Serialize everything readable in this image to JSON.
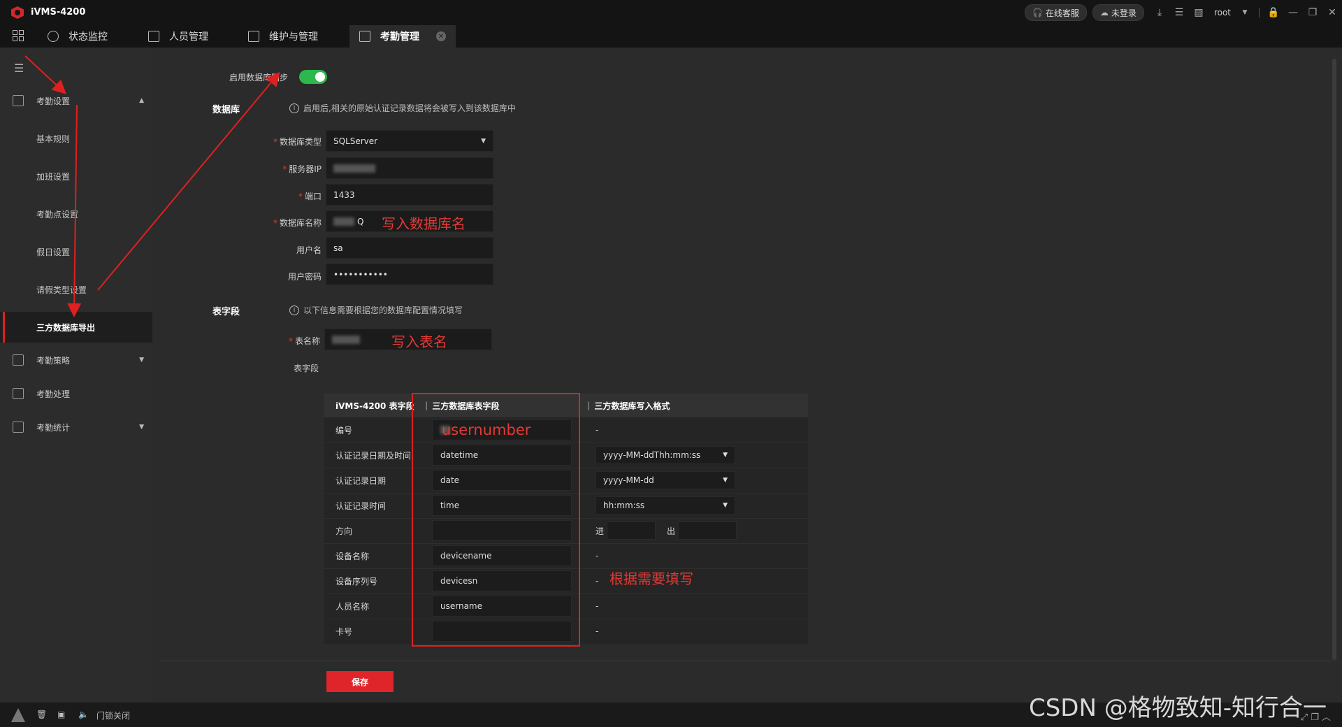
{
  "app": {
    "title": "iVMS-4200"
  },
  "titlebar": {
    "online_service": "在线客服",
    "not_logged_in": "未登录",
    "user": "root"
  },
  "tabs": [
    {
      "label": "状态监控"
    },
    {
      "label": "人员管理"
    },
    {
      "label": "维护与管理"
    },
    {
      "label": "考勤管理",
      "active": true
    }
  ],
  "sidebar": {
    "groups": [
      {
        "label": "考勤设置",
        "expanded": true,
        "items": [
          {
            "label": "基本规则"
          },
          {
            "label": "加班设置"
          },
          {
            "label": "考勤点设置"
          },
          {
            "label": "假日设置"
          },
          {
            "label": "请假类型设置"
          },
          {
            "label": "三方数据库导出",
            "active": true
          }
        ]
      },
      {
        "label": "考勤策略"
      },
      {
        "label": "考勤处理"
      },
      {
        "label": "考勤统计"
      }
    ]
  },
  "form": {
    "enable_sync_label": "启用数据库同步",
    "enable_sync": true,
    "db_section": "数据库",
    "db_hint": "启用后,相关的原始认证记录数据将会被写入到该数据库中",
    "db_type_label": "数据库类型",
    "db_type": "SQLServer",
    "server_ip_label": "服务器IP",
    "port_label": "端口",
    "port": "1433",
    "db_name_label": "数据库名称",
    "db_name_suffix": "Q",
    "username_label": "用户名",
    "username": "sa",
    "password_label": "用户密码",
    "password": "•••••••••••",
    "field_section": "表字段",
    "field_hint": "以下信息需要根据您的数据库配置情况填写",
    "table_name_label": "表名称",
    "table_fields_label": "表字段"
  },
  "annotations": {
    "db_name": "写入数据库名",
    "table_name": "写入表名",
    "fields": "根据需要填写",
    "usernumber": "usernumber"
  },
  "table": {
    "headers": [
      "iVMS-4200 表字段",
      "三方数据库表字段",
      "三方数据库写入格式"
    ],
    "rows": [
      {
        "field": "编号",
        "db_field": "",
        "format": "-"
      },
      {
        "field": "认证记录日期及时间",
        "db_field": "datetime",
        "format": "yyyy-MM-ddThh:mm:ss"
      },
      {
        "field": "认证记录日期",
        "db_field": "date",
        "format": "yyyy-MM-dd"
      },
      {
        "field": "认证记录时间",
        "db_field": "time",
        "format": "hh:mm:ss"
      },
      {
        "field": "方向",
        "db_field": "",
        "format": ""
      },
      {
        "field": "设备名称",
        "db_field": "devicename",
        "format": "-"
      },
      {
        "field": "设备序列号",
        "db_field": "devicesn",
        "format": "-"
      },
      {
        "field": "人员名称",
        "db_field": "username",
        "format": "-"
      },
      {
        "field": "卡号",
        "db_field": "",
        "format": "-"
      }
    ],
    "direction_in": "进",
    "direction_out": "出"
  },
  "actions": {
    "save": "保存"
  },
  "statusbar": {
    "door": "门锁关闭"
  },
  "watermark": "CSDN @格物致知-知行合一",
  "colors": {
    "accent": "#e02020",
    "toggle_on": "#2db84d",
    "annotation": "#e53935"
  }
}
